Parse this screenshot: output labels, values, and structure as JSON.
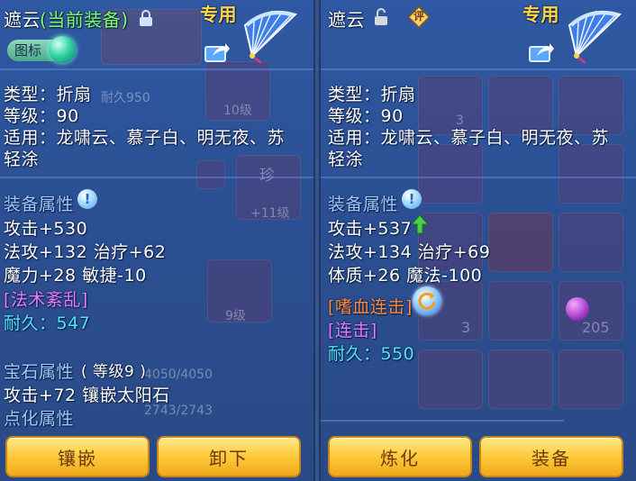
{
  "left": {
    "name": "遮云",
    "status": "(当前装备)",
    "tag": "专用",
    "icon_toggle_label": "图标",
    "type_line": "类型：折扇",
    "level_line": "等级：90",
    "fit_line1": "适用：龙啸云、慕子白、明无夜、苏",
    "fit_line2": "轻涂",
    "attr_header": "装备属性",
    "attack": "攻击+530",
    "stat2": "法攻+132 治疗+62",
    "stat3": "魔力+28 敏捷-10",
    "special": "[法术紊乱]",
    "durability": "耐久：547",
    "gem_header": "宝石属性",
    "gem_level": "( 等级9 )",
    "gem_stat": "攻击+72 镶嵌太阳石",
    "dot_header": "点化属性",
    "btn1": "镶嵌",
    "btn2": "卸下"
  },
  "right": {
    "name": "遮云",
    "review_label": "评",
    "tag": "专用",
    "type_line": "类型：折扇",
    "level_line": "等级：90",
    "fit_line1": "适用：龙啸云、慕子白、明无夜、苏",
    "fit_line2": "轻涂",
    "attr_header": "装备属性",
    "attack": "攻击+537",
    "stat2": "法攻+134 治疗+69",
    "stat3": "体质+26 魔法-100",
    "special1": "[嗜血连击]",
    "special2": "[连击]",
    "durability": "耐久：550",
    "btn1": "炼化",
    "btn2": "装备"
  },
  "background": {
    "left_texts": [
      "耐久950",
      "10级",
      "珍",
      "+11级",
      "9级",
      "4050/4050",
      "2743/2743"
    ],
    "right_texts": [
      "3",
      "3",
      "205"
    ]
  },
  "colors": {
    "accent_gold": "#ffd54a",
    "cyan": "#4fe3ff",
    "purple": "#e67bff",
    "orange": "#ff8a3c",
    "up_arrow": "#4ad04a"
  }
}
